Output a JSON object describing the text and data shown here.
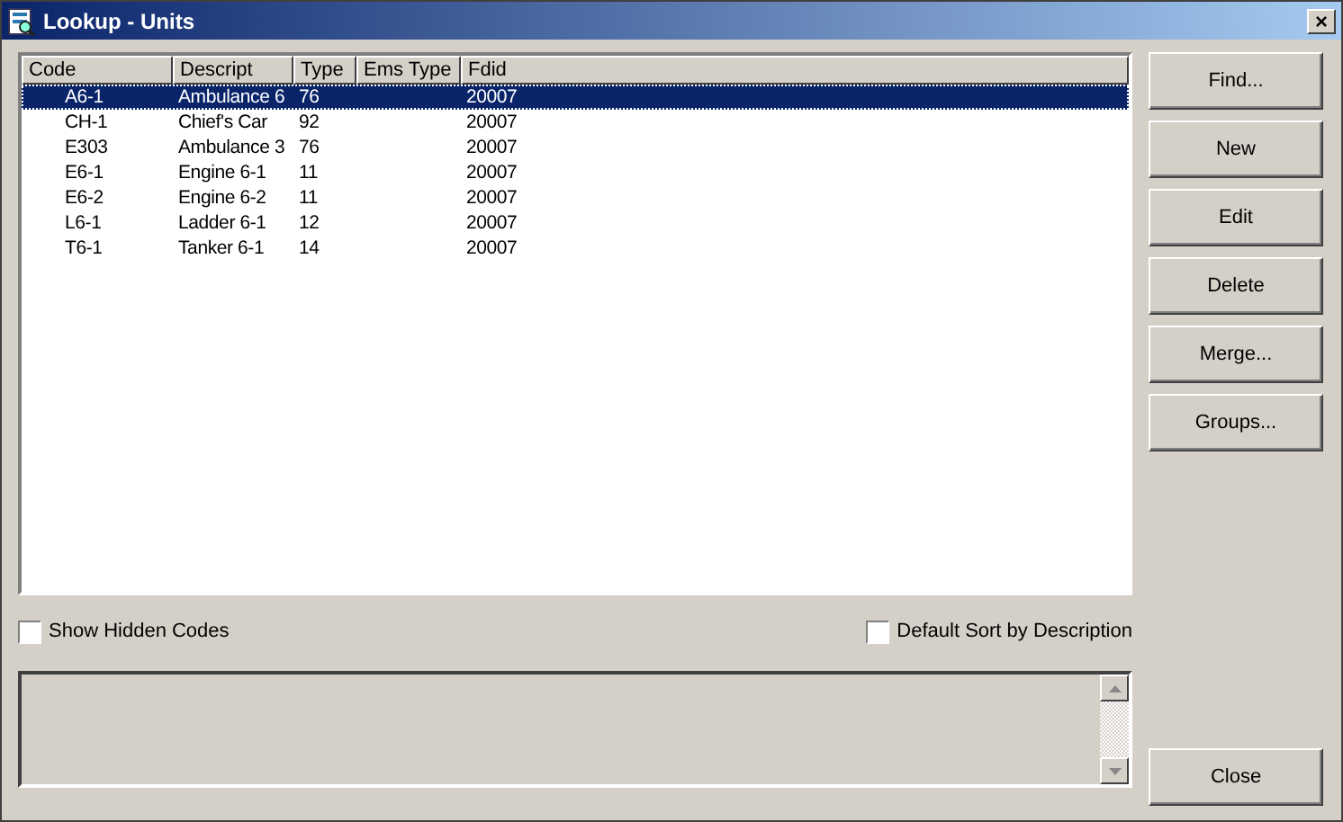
{
  "window": {
    "title": "Lookup - Units",
    "close": "×"
  },
  "table": {
    "columns": [
      "Code",
      "Descript",
      "Type",
      "Ems Type",
      "Fdid"
    ],
    "rows": [
      {
        "cells": [
          "A6-1",
          "Ambulance 6",
          "76",
          "",
          "20007"
        ],
        "selected": true
      },
      {
        "cells": [
          "CH-1",
          "Chief's Car",
          "92",
          "",
          "20007"
        ],
        "selected": false
      },
      {
        "cells": [
          "E303",
          "Ambulance 3",
          "76",
          "",
          "20007"
        ],
        "selected": false
      },
      {
        "cells": [
          "E6-1",
          "Engine 6-1",
          "11",
          "",
          "20007"
        ],
        "selected": false
      },
      {
        "cells": [
          "E6-2",
          "Engine 6-2",
          "11",
          "",
          "20007"
        ],
        "selected": false
      },
      {
        "cells": [
          "L6-1",
          "Ladder 6-1",
          "12",
          "",
          "20007"
        ],
        "selected": false
      },
      {
        "cells": [
          "T6-1",
          "Tanker 6-1",
          "14",
          "",
          "20007"
        ],
        "selected": false
      }
    ]
  },
  "options": [
    {
      "label": "Show Hidden Codes",
      "checked": false
    },
    {
      "label": "Default Sort by Description",
      "checked": false
    }
  ],
  "buttons": [
    "Find...",
    "New",
    "Edit",
    "Delete",
    "Merge...",
    "Groups..."
  ],
  "close_button": "Close"
}
